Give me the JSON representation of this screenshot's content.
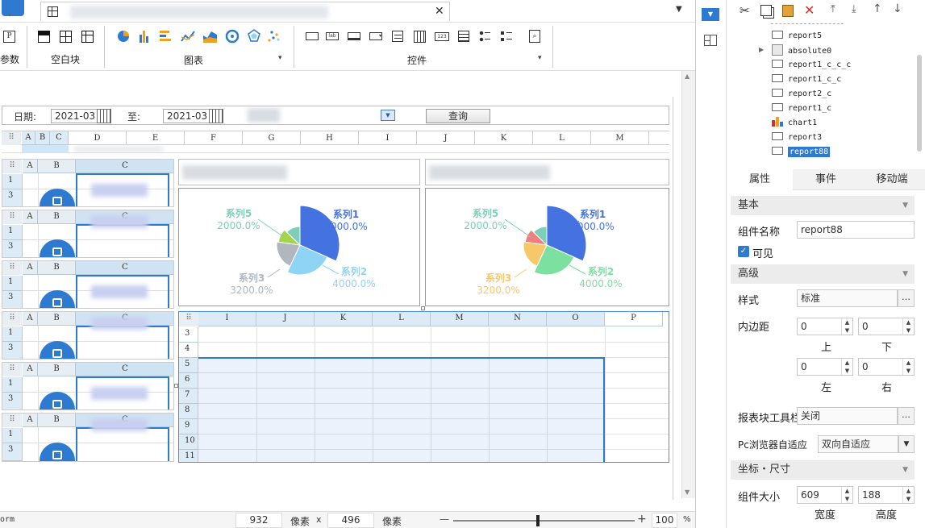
{
  "ribbon": {
    "param_label": "参数",
    "blank_block_label": "空白块",
    "chart_label": "图表",
    "widget_label": "控件",
    "widget_icons": [
      "lab",
      "123"
    ]
  },
  "param_bar": {
    "date_label": "日期:",
    "date_from": "2021-03",
    "to_label": "至:",
    "date_to": "2021-03",
    "query_button": "查询"
  },
  "sheet_top": {
    "cols": [
      "A",
      "B",
      "C",
      "D",
      "E",
      "F",
      "G",
      "H",
      "I",
      "J",
      "K",
      "L",
      "M"
    ]
  },
  "small_grid": {
    "cols": [
      "A",
      "B",
      "C"
    ],
    "rows": [
      "1",
      "3"
    ]
  },
  "big_grid": {
    "cols": [
      "I",
      "J",
      "K",
      "L",
      "M",
      "N",
      "O",
      "P"
    ],
    "rows": [
      "3",
      "4",
      "5",
      "6",
      "7",
      "8",
      "9",
      "10",
      "11"
    ]
  },
  "colors": {
    "series1": "#4472e0",
    "series2": "#8fd3f5",
    "series3": "#b0b7be",
    "series4": "#a4d44c",
    "series5": "#7ecfb8",
    "series3_alt": "#f6c86a",
    "series4_alt": "#f07f7f",
    "series2_alt": "#7be0a0",
    "selection": "#2e7ad1",
    "header_bg": "#dcebf5"
  },
  "chart_data": [
    {
      "type": "pie",
      "series": [
        {
          "name": "系列1",
          "value": 5000,
          "label": "5000.0%"
        },
        {
          "name": "系列2",
          "value": 4000,
          "label": "4000.0%"
        },
        {
          "name": "系列3",
          "value": 3200,
          "label": "3200.0%"
        },
        {
          "name": "系列5",
          "value": 2000,
          "label": "2000.0%"
        }
      ]
    },
    {
      "type": "pie",
      "series": [
        {
          "name": "系列1",
          "value": 5000,
          "label": "5000.0%"
        },
        {
          "name": "系列2",
          "value": 4000,
          "label": "4000.0%"
        },
        {
          "name": "系列3",
          "value": 3200,
          "label": "3200.0%"
        },
        {
          "name": "系列5",
          "value": 2000,
          "label": "2000.0%"
        }
      ]
    }
  ],
  "status": {
    "left_text": "orm",
    "width_value": "932",
    "width_unit": "像素",
    "times": "x",
    "height_value": "496",
    "height_unit": "像素",
    "minus": "—",
    "plus": "+",
    "zoom": "100",
    "percent": "%"
  },
  "tree": {
    "items": [
      {
        "label": "report5",
        "icon": "report-icon"
      },
      {
        "label": "absolute0",
        "icon": "absolute-icon"
      },
      {
        "label": "report1_c_c_c",
        "icon": "report-icon"
      },
      {
        "label": "report1_c_c",
        "icon": "report-icon"
      },
      {
        "label": "report2_c",
        "icon": "report-icon"
      },
      {
        "label": "report1_c",
        "icon": "report-icon"
      },
      {
        "label": "chart1",
        "icon": "chart-icon"
      },
      {
        "label": "report3",
        "icon": "report-icon"
      },
      {
        "label": "report88",
        "icon": "report-icon"
      }
    ]
  },
  "props": {
    "tabs": [
      "属性",
      "事件",
      "移动端"
    ],
    "basic": "基本",
    "name_label": "组件名称",
    "name_value": "report88",
    "visible_label": "可见",
    "advanced": "高级",
    "style_label": "样式",
    "style_value": "标准",
    "padding_label": "内边距",
    "pad_top": "0",
    "pad_bottom": "0",
    "pad_left": "0",
    "pad_right": "0",
    "top_label": "上",
    "bottom_label": "下",
    "left_label": "左",
    "right_label": "右",
    "toolbar_label": "报表块工具栏",
    "toolbar_value": "关闭",
    "pc_label": "Pc浏览器自适应",
    "pc_value": "双向自适应",
    "coord": "坐标・尺寸",
    "size_label": "组件大小",
    "width": "609",
    "height": "188",
    "width_label": "宽度",
    "height_label": "高度",
    "ellipsis": "…"
  }
}
